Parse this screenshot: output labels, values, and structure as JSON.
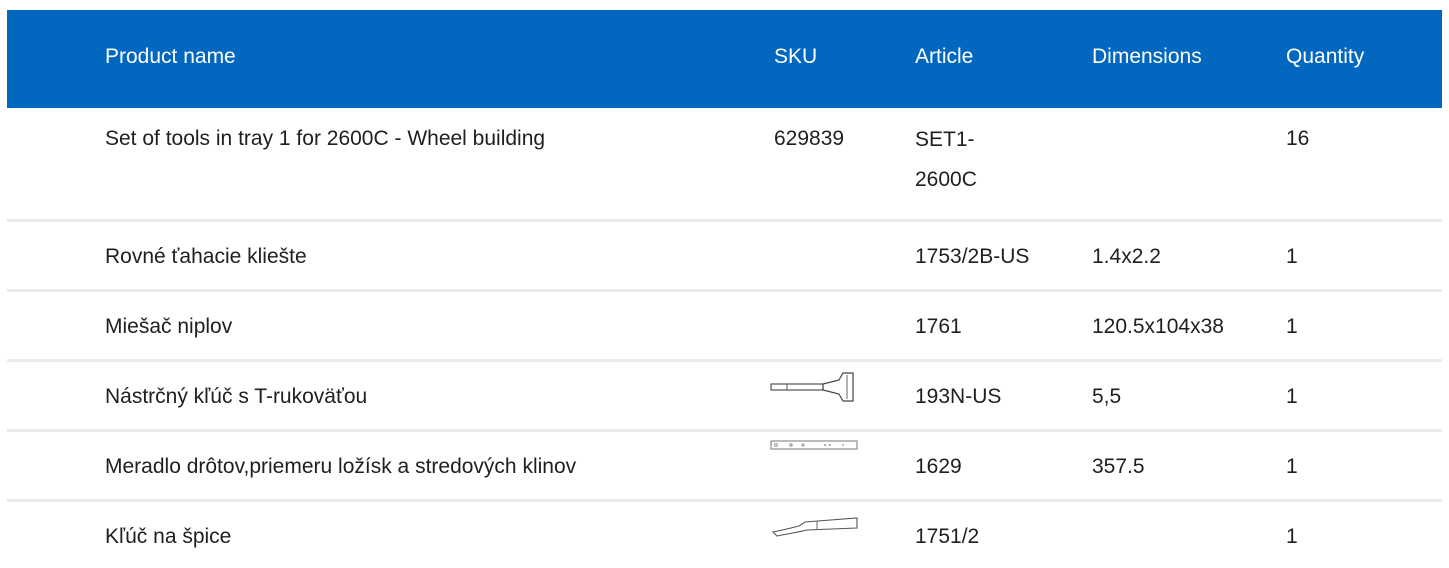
{
  "columns": {
    "name": "Product name",
    "sku": "SKU",
    "article": "Article",
    "dimensions": "Dimensions",
    "quantity": "Quantity"
  },
  "rows": [
    {
      "name": "Set of tools in tray 1 for 2600C - Wheel building",
      "sku": "629839",
      "article": "SET1-2600C",
      "dimensions": "",
      "quantity": "16",
      "image": ""
    },
    {
      "name": "Rovné ťahacie kliešte",
      "sku": "",
      "article": "1753/2B-US",
      "dimensions": "1.4x2.2",
      "quantity": "1",
      "image": ""
    },
    {
      "name": "Miešač niplov",
      "sku": "",
      "article": "1761",
      "dimensions": "120.5x104x38",
      "quantity": "1",
      "image": ""
    },
    {
      "name": "Nástrčný kľúč s T-rukoväťou",
      "sku": "",
      "article": "193N-US",
      "dimensions": "5,5",
      "quantity": "1",
      "image": "t-handle-wrench-icon"
    },
    {
      "name": "Meradlo drôtov,priemeru ložísk a stredových klinov",
      "sku": "",
      "article": "1629",
      "dimensions": "357.5",
      "quantity": "1",
      "image": "wire-gauge-icon"
    },
    {
      "name": "Kľúč na špice",
      "sku": "",
      "article": "1751/2",
      "dimensions": "",
      "quantity": "1",
      "image": "spoke-wrench-icon"
    }
  ],
  "colors": {
    "header_bg": "#0268bf",
    "header_text": "#ffffff",
    "divider": "#e9ebee"
  }
}
